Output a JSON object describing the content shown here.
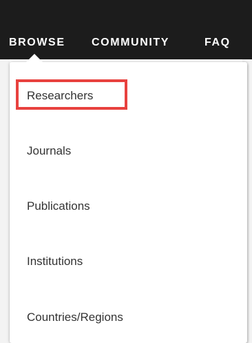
{
  "nav": {
    "items": [
      {
        "label": "BROWSE"
      },
      {
        "label": "COMMUNITY"
      },
      {
        "label": "FAQ"
      }
    ]
  },
  "dropdown": {
    "items": [
      {
        "label": "Researchers",
        "highlighted": true
      },
      {
        "label": "Journals"
      },
      {
        "label": "Publications"
      },
      {
        "label": "Institutions"
      },
      {
        "label": "Countries/Regions"
      }
    ]
  },
  "colors": {
    "topbar_background": "#1c1c1c",
    "nav_text": "#ffffff",
    "menu_text": "#333333",
    "highlight_border": "#e8413e"
  }
}
